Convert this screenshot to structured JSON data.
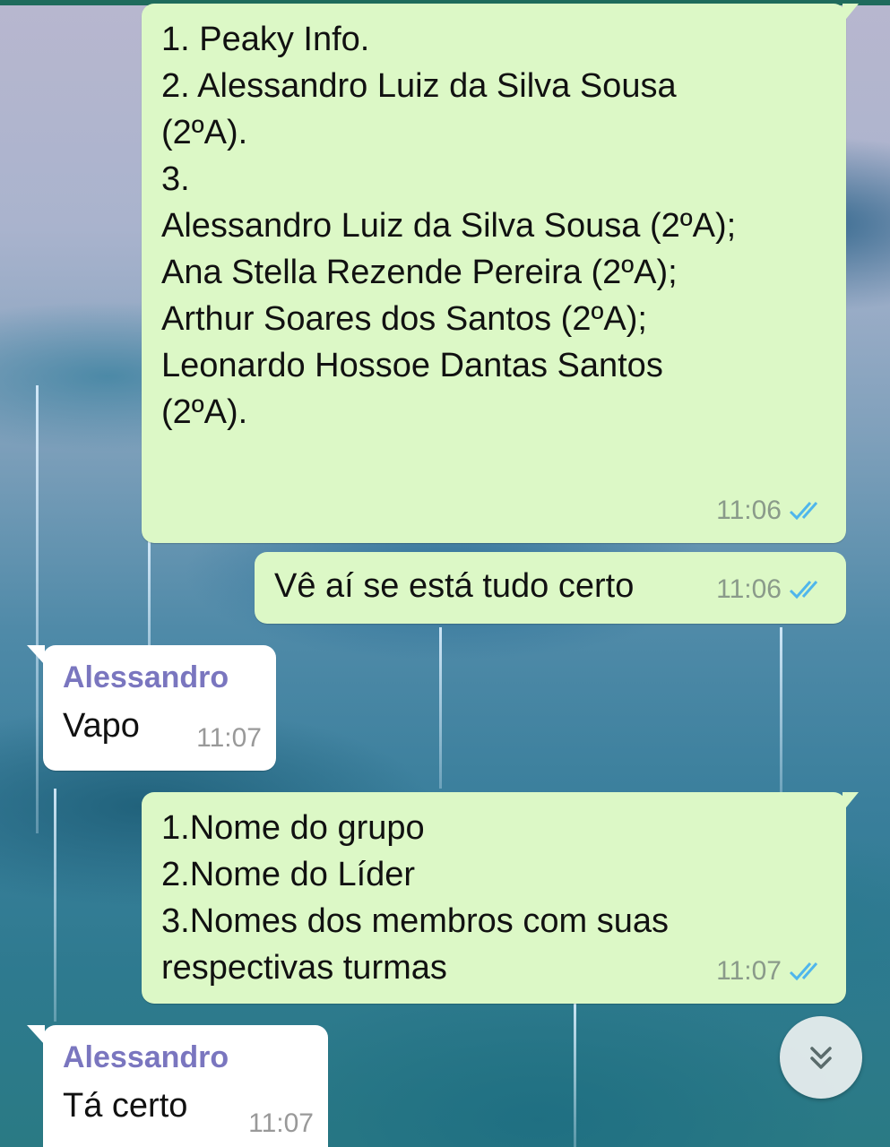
{
  "messages": [
    {
      "direction": "outgoing",
      "lines": [
        "1. Peaky Info.",
        "",
        "2. Alessandro Luiz da Silva Sousa",
        "(2ºA).",
        "",
        "3.",
        "Alessandro Luiz da Silva Sousa (2ºA);",
        "Ana Stella Rezende Pereira (2ºA);",
        "Arthur Soares dos Santos (2ºA);",
        "Leonardo Hossoe Dantas Santos",
        "(2ºA)."
      ],
      "time": "11:06",
      "status": "read"
    },
    {
      "direction": "outgoing",
      "text": "Vê aí se está tudo certo",
      "time": "11:06",
      "status": "read"
    },
    {
      "direction": "incoming",
      "sender": "Alessandro",
      "text": "Vapo",
      "time": "11:07"
    },
    {
      "direction": "outgoing",
      "lines": [
        "1.Nome do grupo",
        "2.Nome do Líder",
        "3.Nomes dos membros com suas",
        "respectivas turmas"
      ],
      "time": "11:07",
      "status": "read"
    },
    {
      "direction": "incoming",
      "sender": "Alessandro",
      "text": "Tá certo",
      "time": "11:07"
    }
  ],
  "colors": {
    "outgoing_bubble": "#dcf8c6",
    "incoming_bubble": "#ffffff",
    "sender_name": "#7a76bf",
    "read_ticks": "#4fb6ec"
  },
  "scroll_button": {
    "icon": "double-chevron-down-icon"
  }
}
